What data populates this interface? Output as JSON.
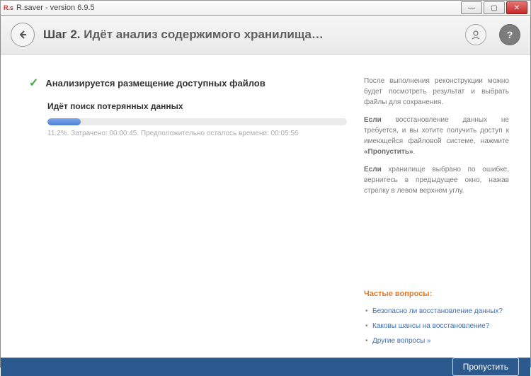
{
  "window": {
    "icon_text": "R.s",
    "title": "R.saver - version 6.9.5"
  },
  "header": {
    "step_prefix": "Шаг 2.",
    "step_text": "Идёт анализ содержимого хранилища…"
  },
  "main": {
    "completed_task": "Анализируется размещение доступных файлов",
    "current_task": "Идёт поиск потерянных данных",
    "progress_percent": 11.2,
    "progress_text": "11.2%. Затрачено: 00:00:45. Предположительно осталось времени: 00:05:56"
  },
  "sidebar": {
    "p1": "После выполнения реконструкции можно будет посмотреть результат и выбрать файлы для сохранения.",
    "p2_bold": "Если",
    "p2_rest": " восстановление данных не требуется, и вы хотите получить доступ к имеющейся файловой системе, нажмите ",
    "p2_btn": "«Пропустить»",
    "p3_bold": "Если",
    "p3_rest": " хранилище выбрано по ошибке, вернитесь в предыдущее окно, нажав стрелку в левом верхнем углу.",
    "faq_title": "Частые вопросы:",
    "faq": [
      "Безопасно ли восстановление данных?",
      "Каковы шансы на восстановление?",
      "Другие вопросы »"
    ]
  },
  "footer": {
    "skip": "Пропустить"
  }
}
